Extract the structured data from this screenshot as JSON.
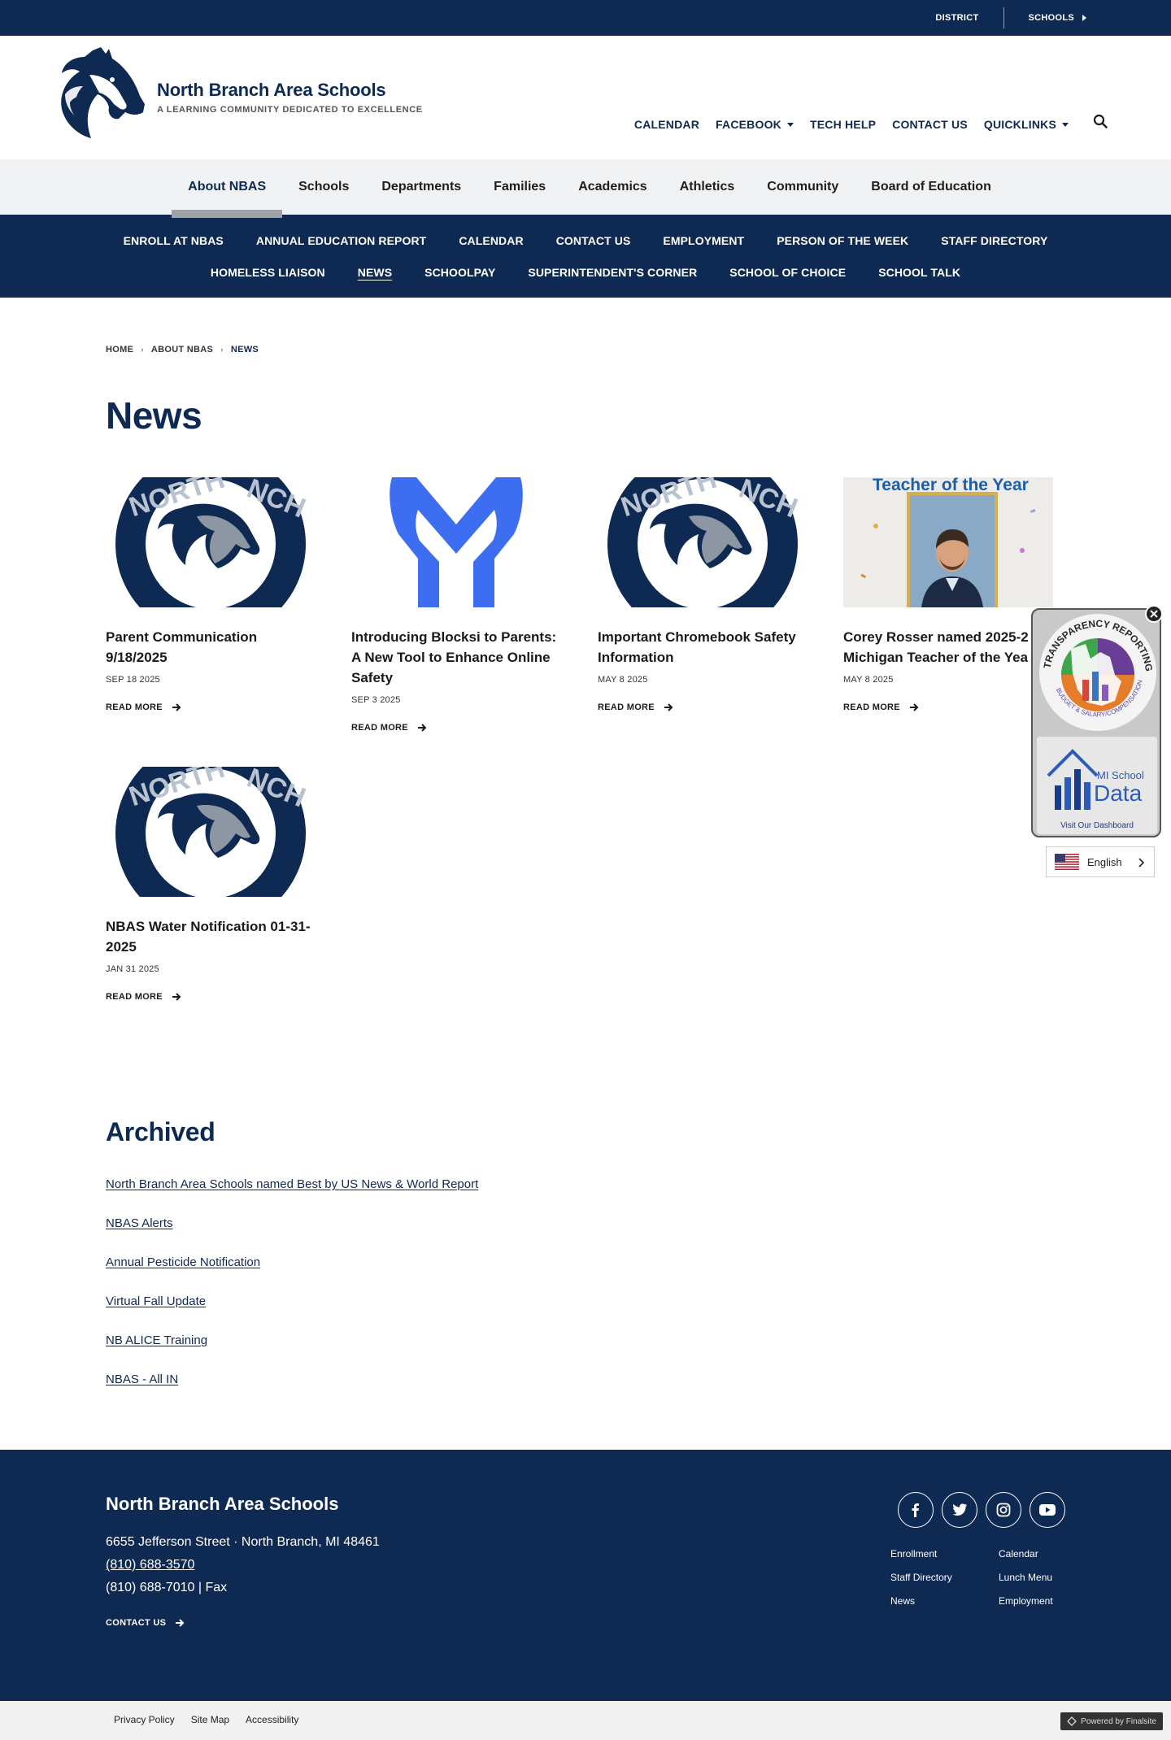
{
  "utility": {
    "district": "DISTRICT",
    "schools": "SCHOOLS"
  },
  "brand": {
    "title": "North Branch Area Schools",
    "tagline": "A LEARNING COMMUNITY DEDICATED TO EXCELLENCE"
  },
  "header_nav": [
    "CALENDAR",
    "FACEBOOK",
    "TECH HELP",
    "CONTACT US",
    "QUICKLINKS"
  ],
  "main_nav": [
    "About NBAS",
    "Schools",
    "Departments",
    "Families",
    "Academics",
    "Athletics",
    "Community",
    "Board of Education"
  ],
  "sub_nav_row1": [
    "ENROLL AT NBAS",
    "ANNUAL EDUCATION REPORT",
    "CALENDAR",
    "CONTACT US",
    "EMPLOYMENT",
    "PERSON OF THE WEEK",
    "STAFF DIRECTORY"
  ],
  "sub_nav_row2": [
    "HOMELESS LIAISON",
    "NEWS",
    "SCHOOLPAY",
    "SUPERINTENDENT'S CORNER",
    "SCHOOL OF CHOICE",
    "SCHOOL TALK"
  ],
  "breadcrumb": [
    "HOME",
    "ABOUT NBAS",
    "NEWS"
  ],
  "page_title": "News",
  "read_more": "READ MORE",
  "news": [
    {
      "title": "Parent Communication 9/18/2025",
      "date": "SEP 18 2025",
      "image": "nb-logo"
    },
    {
      "title": "Introducing Blocksi to Parents: A New Tool to Enhance Online Safety",
      "date": "SEP 3 2025",
      "image": "blocksi-logo"
    },
    {
      "title": "Important Chromebook Safety Information",
      "date": "MAY 8 2025",
      "image": "nb-logo"
    },
    {
      "title": "Corey Rosser named 2025-2 Michigan Teacher of the Yea",
      "date": "MAY 8 2025",
      "image": "teacher-photo",
      "image_caption": "Teacher of the Year"
    },
    {
      "title": "NBAS Water Notification 01-31-2025",
      "date": "JAN 31 2025",
      "image": "nb-logo"
    }
  ],
  "archived": {
    "title": "Archived",
    "links": [
      "North Branch Area Schools named Best by US News & World Report",
      "NBAS Alerts",
      "Annual Pesticide Notification",
      "Virtual Fall Update",
      "NB ALICE Training",
      "NBAS - All IN"
    ]
  },
  "footer": {
    "name": "North Branch Area Schools",
    "street": "6655 Jefferson Street",
    "city": "North Branch, MI  48461",
    "phone": "(810) 688-3570",
    "fax": "(810) 688-7010 | Fax",
    "contact": "CONTACT US",
    "links": [
      "Enrollment",
      "Calendar",
      "Staff Directory",
      "Lunch Menu",
      "News",
      "Employment"
    ],
    "social": [
      "facebook-icon",
      "twitter-icon",
      "instagram-icon",
      "youtube-icon"
    ]
  },
  "bottom": {
    "links": [
      "Privacy Policy",
      "Site Map",
      "Accessibility"
    ],
    "powered": "Powered by Finalsite"
  },
  "widget": {
    "mi": "MI School",
    "data": "Data",
    "dashboard": "Visit Our Dashboard"
  },
  "language": {
    "selected": "English"
  },
  "colors": {
    "navy": "#0f2a52",
    "blocksi_blue": "#3d6ef2",
    "gray_band": "#f1f2f3"
  }
}
